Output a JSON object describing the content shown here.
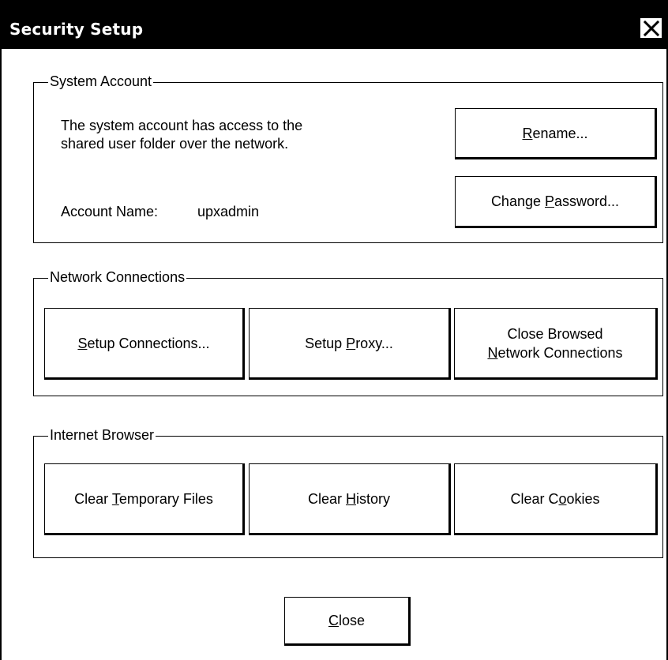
{
  "dialog": {
    "title": "Security Setup"
  },
  "system_account": {
    "label": "System Account",
    "description_line1": "The system account has access to the",
    "description_line2": "shared user folder over the network.",
    "account_name_label": "Account Name:",
    "account_name_value": "upxadmin",
    "rename_button": {
      "pre": "",
      "key": "R",
      "post": "ename..."
    },
    "change_password_button": {
      "pre": "Change ",
      "key": "P",
      "post": "assword..."
    }
  },
  "network_connections": {
    "label": "Network Connections",
    "setup_connections_button": {
      "pre": "",
      "key": "S",
      "post": "etup Connections..."
    },
    "setup_proxy_button": {
      "pre": "Setup ",
      "key": "P",
      "post": "roxy..."
    },
    "close_browsed_button": {
      "line1": "Close Browsed",
      "line2_pre": "",
      "line2_key": "N",
      "line2_post": "etwork Connections"
    }
  },
  "internet_browser": {
    "label": "Internet Browser",
    "clear_temp_button": {
      "pre": "Clear ",
      "key": "T",
      "post": "emporary Files"
    },
    "clear_history_button": {
      "pre": "Clear ",
      "key": "H",
      "post": "istory"
    },
    "clear_cookies_button": {
      "pre": "Clear C",
      "key": "o",
      "post": "okies"
    }
  },
  "footer": {
    "close_button": {
      "pre": "",
      "key": "C",
      "post": "lose"
    }
  }
}
